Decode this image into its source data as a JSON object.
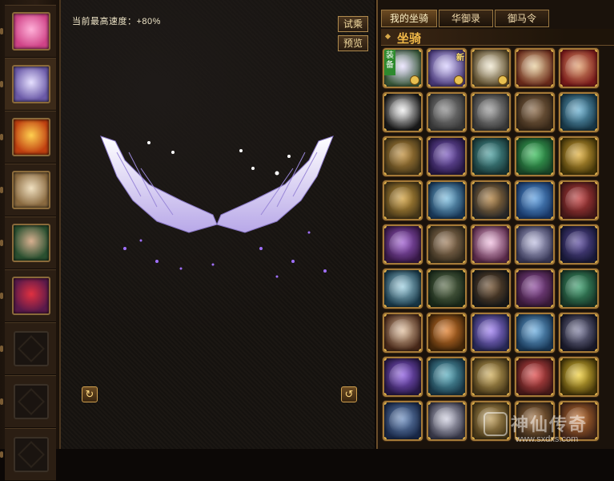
{
  "preview": {
    "speed_label": "当前最高速度：+80%",
    "try_ride_label": "试乘",
    "preview_label": "预览"
  },
  "sidebar": {
    "items": [
      {
        "name": "armor-icon",
        "colors": [
          "#d04488",
          "#ffb0d8"
        ]
      },
      {
        "name": "wing-icon",
        "colors": [
          "#6b5aa8",
          "#e6e0ff"
        ]
      },
      {
        "name": "sun-orb-icon",
        "colors": [
          "#c04010",
          "#ffd050"
        ]
      },
      {
        "name": "scroll-icon",
        "colors": [
          "#8a6a40",
          "#f0e0c0"
        ]
      },
      {
        "name": "hero-portrait-icon",
        "colors": [
          "#2a5030",
          "#d8b090"
        ]
      },
      {
        "name": "red-crystal-icon",
        "colors": [
          "#5a1a4a",
          "#e03040"
        ]
      }
    ]
  },
  "tabs": [
    "我的坐骑",
    "华御录",
    "御马令"
  ],
  "section_title": "坐骑",
  "mounts": [
    {
      "colors": [
        "#3a5a3a",
        "#e8e0ff"
      ],
      "equipped": true,
      "label": "装备",
      "timed": true
    },
    {
      "colors": [
        "#4a3a7a",
        "#d8d0ff"
      ],
      "new_label": "新",
      "timed": true
    },
    {
      "colors": [
        "#5a4a2a",
        "#f0e8d0"
      ],
      "timed": true
    },
    {
      "colors": [
        "#6a2a1a",
        "#e8d0a0"
      ]
    },
    {
      "colors": [
        "#7a1a1a",
        "#e0a070"
      ]
    },
    {
      "colors": [
        "#1a1a1a",
        "#f0f0f0"
      ]
    },
    {
      "colors": [
        "#3a3a3a",
        "#8a8a8a"
      ]
    },
    {
      "colors": [
        "#3a3a3a",
        "#9a9a9a"
      ]
    },
    {
      "colors": [
        "#3a2a1a",
        "#8a6a4a"
      ]
    },
    {
      "colors": [
        "#1a3a4a",
        "#6ab0d0"
      ]
    },
    {
      "colors": [
        "#4a3a1a",
        "#c09040"
      ]
    },
    {
      "colors": [
        "#2a1a4a",
        "#8060c0"
      ]
    },
    {
      "colors": [
        "#1a3a3a",
        "#50a0a0"
      ]
    },
    {
      "colors": [
        "#1a4a2a",
        "#40c060"
      ]
    },
    {
      "colors": [
        "#4a3a0a",
        "#e0b040"
      ]
    },
    {
      "colors": [
        "#4a3a1a",
        "#d0a040"
      ]
    },
    {
      "colors": [
        "#1a3a5a",
        "#80c0e0"
      ]
    },
    {
      "colors": [
        "#2a2a2a",
        "#b08040"
      ]
    },
    {
      "colors": [
        "#1a3a6a",
        "#60a0e0"
      ]
    },
    {
      "colors": [
        "#4a1a1a",
        "#c04040"
      ]
    },
    {
      "colors": [
        "#3a1a4a",
        "#a060d0"
      ]
    },
    {
      "colors": [
        "#3a3020",
        "#a08060"
      ]
    },
    {
      "colors": [
        "#5a2a4a",
        "#f0c0e0"
      ]
    },
    {
      "colors": [
        "#3a3a5a",
        "#c0c0e0"
      ]
    },
    {
      "colors": [
        "#1a1a3a",
        "#6050a0"
      ]
    },
    {
      "colors": [
        "#1a3a4a",
        "#a0d0e0"
      ]
    },
    {
      "colors": [
        "#1a2a1a",
        "#607050"
      ]
    },
    {
      "colors": [
        "#1a1a1a",
        "#705030"
      ]
    },
    {
      "colors": [
        "#3a1a3a",
        "#9050a0"
      ]
    },
    {
      "colors": [
        "#1a3a2a",
        "#40a070"
      ]
    },
    {
      "colors": [
        "#4a2a1a",
        "#e0c0a0"
      ]
    },
    {
      "colors": [
        "#4a2a0a",
        "#e08030"
      ]
    },
    {
      "colors": [
        "#2a2a5a",
        "#a080f0"
      ]
    },
    {
      "colors": [
        "#1a3a5a",
        "#70b0e0"
      ]
    },
    {
      "colors": [
        "#1a1a2a",
        "#8080a0"
      ]
    },
    {
      "colors": [
        "#2a1a4a",
        "#9060e0"
      ]
    },
    {
      "colors": [
        "#1a3a4a",
        "#60b0c0"
      ]
    },
    {
      "colors": [
        "#4a3a1a",
        "#d0b060"
      ]
    },
    {
      "colors": [
        "#4a1a1a",
        "#e05050"
      ]
    },
    {
      "colors": [
        "#4a3a0a",
        "#f0d040"
      ]
    },
    {
      "colors": [
        "#1a2a4a",
        "#7090c0"
      ]
    },
    {
      "colors": [
        "#3a3a4a",
        "#d0d0e0"
      ]
    },
    {
      "colors": [
        "#4a3a1a",
        "#c0a060"
      ]
    },
    {
      "colors": [
        "#3a2a1a",
        "#a07040"
      ]
    },
    {
      "colors": [
        "#4a2a1a",
        "#c07030"
      ]
    }
  ],
  "watermark": {
    "title": "神仙传奇",
    "url": "www.sxdxs.com"
  }
}
